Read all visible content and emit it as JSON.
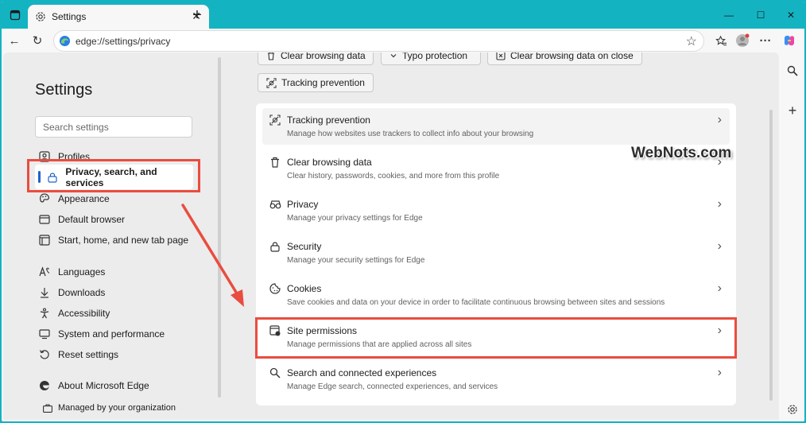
{
  "window": {
    "tab_title": "Settings",
    "new_tab_symbol": "+",
    "close_tab_symbol": "✕",
    "controls": {
      "minimize": "—",
      "maximize": "☐",
      "close": "✕"
    }
  },
  "toolbar": {
    "url": "edge://settings/privacy",
    "back_symbol": "←",
    "reload_symbol": "↻",
    "favorite_symbol": "☆",
    "more_symbol": "···"
  },
  "sidebar": {
    "title": "Settings",
    "search_placeholder": "Search settings",
    "items": [
      {
        "label": "Profiles",
        "icon": "profile-icon"
      },
      {
        "label": "Privacy, search, and services",
        "icon": "lock-icon",
        "active": true
      },
      {
        "label": "Appearance",
        "icon": "palette-icon"
      },
      {
        "label": "Default browser",
        "icon": "browser-icon"
      },
      {
        "label": "Start, home, and new tab page",
        "icon": "home-icon"
      },
      {
        "label": "Languages",
        "icon": "languages-icon"
      },
      {
        "label": "Downloads",
        "icon": "download-icon"
      },
      {
        "label": "Accessibility",
        "icon": "accessibility-icon"
      },
      {
        "label": "System and performance",
        "icon": "system-icon"
      },
      {
        "label": "Reset settings",
        "icon": "reset-icon"
      },
      {
        "label": "About Microsoft Edge",
        "icon": "edge-logo-icon"
      }
    ],
    "managed_text": "Managed by your organization"
  },
  "quick_buttons": [
    {
      "label": "Clear browsing data"
    },
    {
      "label": "Typo protection"
    },
    {
      "label": "Clear browsing data on close"
    },
    {
      "label": "Tracking prevention"
    }
  ],
  "rows": [
    {
      "title": "Tracking prevention",
      "desc": "Manage how websites use trackers to collect info about your browsing",
      "icon": "tracking-icon"
    },
    {
      "title": "Clear browsing data",
      "desc": "Clear history, passwords, cookies, and more from this profile",
      "icon": "trash-icon"
    },
    {
      "title": "Privacy",
      "desc": "Manage your privacy settings for Edge",
      "icon": "glasses-icon"
    },
    {
      "title": "Security",
      "desc": "Manage your security settings for Edge",
      "icon": "lock-icon"
    },
    {
      "title": "Cookies",
      "desc": "Save cookies and data on your device in order to facilitate continuous browsing between sites and sessions",
      "icon": "cookie-icon"
    },
    {
      "title": "Site permissions",
      "desc": "Manage permissions that are applied across all sites",
      "icon": "permissions-icon"
    },
    {
      "title": "Search and connected experiences",
      "desc": "Manage Edge search, connected experiences, and services",
      "icon": "search-icon"
    }
  ],
  "watermark": "WebNots.com",
  "colors": {
    "accent": "#1f63c9",
    "titlebar": "#14b3c2",
    "annotation": "#e94d3f"
  }
}
